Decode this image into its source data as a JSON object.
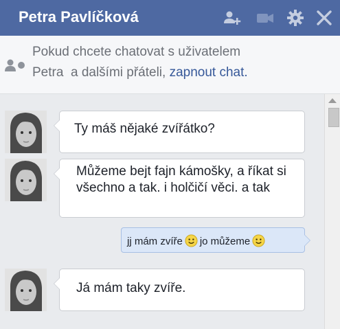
{
  "window": {
    "title": "Petra Pavlíčková",
    "icons": [
      "add-friend-icon",
      "video-call-icon",
      "gear-icon",
      "close-icon"
    ]
  },
  "notice": {
    "line1": "Pokud chcete chatovat s uživatelem",
    "line2_prefix": "Petra  a dalšími přáteli,",
    "link": "zapnout chat."
  },
  "messages": [
    {
      "from": "Petra",
      "text": "Ty máš nějaké zvířátko?"
    },
    {
      "from": "Petra",
      "text": "Můžeme bejt fajn kámošky, a říkat si všechno a tak. i holčičí věci. a tak"
    },
    {
      "from": "me",
      "parts": [
        "jj mám zvíře",
        "jo můžeme"
      ],
      "smileys": [
        "smiley-icon",
        "smiley-icon"
      ]
    },
    {
      "from": "Petra",
      "text": "Já mám taky zvíře."
    }
  ],
  "colors": {
    "titlebar": "#4e69a2",
    "link": "#365899",
    "sent_bubble": "#dbe7f8"
  }
}
